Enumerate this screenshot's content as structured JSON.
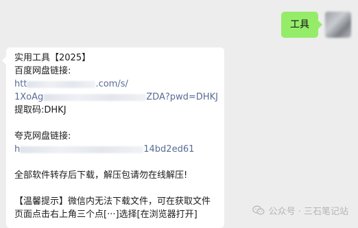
{
  "outgoing_message": {
    "text": "工具"
  },
  "incoming_message": {
    "title": "实用工具【2025】",
    "baidu_label": "百度网盘链接:",
    "baidu_link_line1_start": "htt",
    "baidu_link_line1_end": ".com/s/",
    "baidu_link_line2_start": "1XoAg",
    "baidu_link_line2_end": "ZDA?pwd=DHKJ",
    "baidu_code": "提取码:DHKJ",
    "quark_label": "夸克网盘链接:",
    "quark_link_start": "h",
    "quark_link_end": "14bd2ed61",
    "notice": "全部软件转存后下载，解压包请勿在线解压!",
    "tip": "【温馨提示】微信内无法下载文件，可在获取文件页面点击右上角三个点[···]选择[在浏览器打开]"
  },
  "watermark": {
    "text": "公众号 · 三石笔记站"
  },
  "colors": {
    "chat_background": "#ededed",
    "outgoing_bubble": "#95ec69",
    "incoming_bubble": "#ffffff",
    "link": "#576b95"
  }
}
